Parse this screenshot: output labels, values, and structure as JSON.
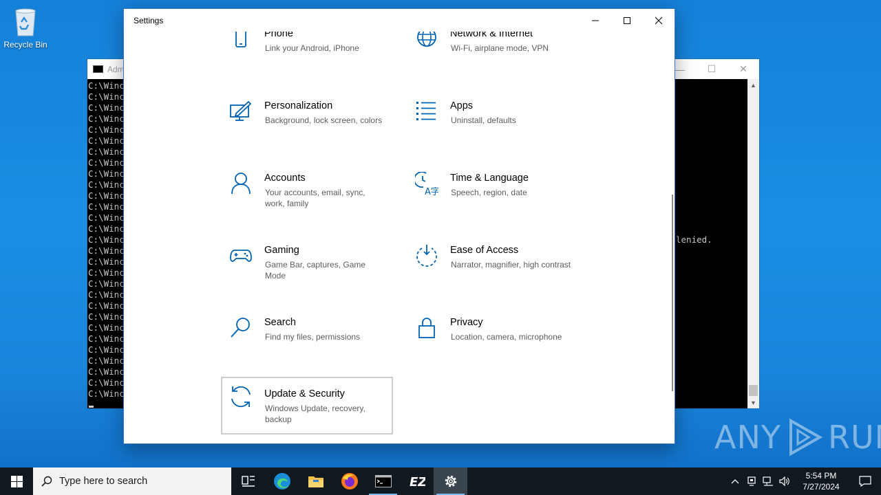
{
  "desktop": {
    "recycle_bin_label": "Recycle Bin"
  },
  "console": {
    "title": "Adm",
    "line_prefix": "C:\\Winc",
    "line_count": 29,
    "partial_text": "lenied."
  },
  "settings": {
    "title": "Settings",
    "tiles": [
      {
        "icon": "phone-icon",
        "title": "Phone",
        "desc": "Link your Android, iPhone"
      },
      {
        "icon": "globe-icon",
        "title": "Network & Internet",
        "desc": "Wi-Fi, airplane mode, VPN"
      },
      {
        "icon": "personalization-icon",
        "title": "Personalization",
        "desc": "Background, lock screen, colors"
      },
      {
        "icon": "apps-icon",
        "title": "Apps",
        "desc": "Uninstall, defaults"
      },
      {
        "icon": "person-icon",
        "title": "Accounts",
        "desc": "Your accounts, email, sync, work, family"
      },
      {
        "icon": "time-language-icon",
        "title": "Time & Language",
        "desc": "Speech, region, date"
      },
      {
        "icon": "gamepad-icon",
        "title": "Gaming",
        "desc": "Game Bar, captures, Game Mode"
      },
      {
        "icon": "ease-of-access-icon",
        "title": "Ease of Access",
        "desc": "Narrator, magnifier, high contrast"
      },
      {
        "icon": "search-icon",
        "title": "Search",
        "desc": "Find my files, permissions"
      },
      {
        "icon": "lock-icon",
        "title": "Privacy",
        "desc": "Location, camera, microphone"
      },
      {
        "icon": "sync-icon",
        "title": "Update & Security",
        "desc": "Windows Update, recovery, backup"
      }
    ]
  },
  "watermark": {
    "left": "ANY",
    "right": "RUN"
  },
  "taskbar": {
    "search_placeholder": "Type here to search",
    "apps": [
      "task-view",
      "edge",
      "file-explorer",
      "firefox",
      "cmd",
      "ez",
      "settings"
    ],
    "time": "5:54 PM",
    "date": "7/27/2024"
  },
  "colors": {
    "accent": "#0063b1",
    "taskbar": "#101820",
    "desktop": "#1a8fe3"
  }
}
